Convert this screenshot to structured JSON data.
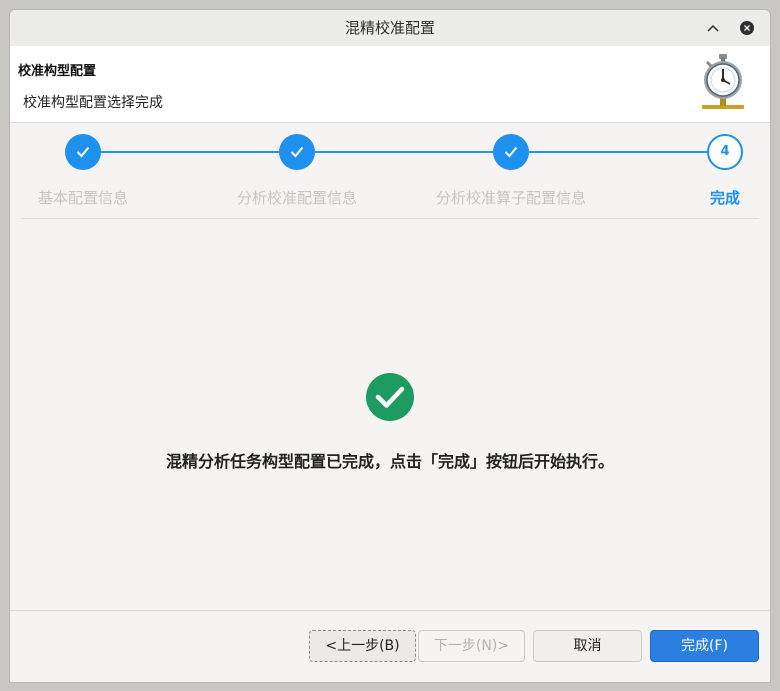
{
  "window": {
    "title": "混精校准配置"
  },
  "header": {
    "title": "校准构型配置",
    "subtitle": "校准构型配置选择完成",
    "icon": "stopwatch-icon"
  },
  "steps": [
    {
      "label": "基本配置信息",
      "status": "done"
    },
    {
      "label": "分析校准配置信息",
      "status": "done"
    },
    {
      "label": "分析校准算子配置信息",
      "status": "done"
    },
    {
      "label": "完成",
      "number": "4",
      "status": "current"
    }
  ],
  "colors": {
    "accent": "#1e90ee",
    "success": "#1e9b60",
    "primary_button": "#2b7fe0"
  },
  "content": {
    "message": "混精分析任务构型配置已完成，点击「完成」按钮后开始执行。"
  },
  "buttons": {
    "prev": "<上一步(B)",
    "next": "下一步(N)>",
    "cancel": "取消",
    "finish": "完成(F)"
  }
}
